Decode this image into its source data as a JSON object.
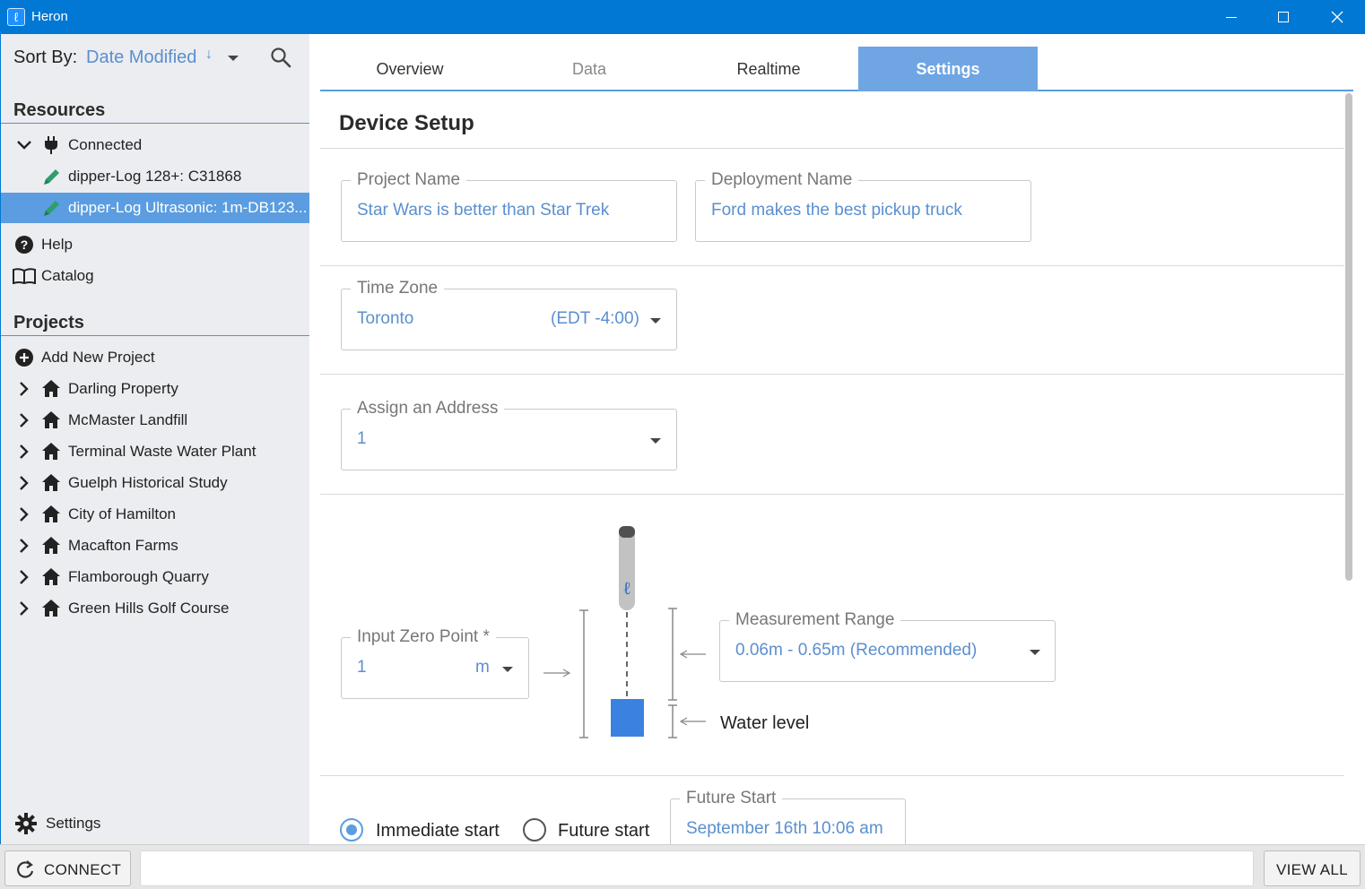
{
  "window": {
    "title": "Heron"
  },
  "sidebar": {
    "sort_label": "Sort By:",
    "sort_value": "Date Modified",
    "sort_direction": "↓",
    "resources_heading": "Resources",
    "connected_label": "Connected",
    "devices": [
      {
        "label": "dipper-Log 128+: C31868"
      },
      {
        "label": "dipper-Log Ultrasonic: 1m-DB123..."
      }
    ],
    "help_label": "Help",
    "catalog_label": "Catalog",
    "projects_heading": "Projects",
    "add_project_label": "Add New Project",
    "projects": [
      {
        "label": "Darling Property"
      },
      {
        "label": "McMaster Landfill"
      },
      {
        "label": "Terminal Waste Water Plant"
      },
      {
        "label": "Guelph Historical Study"
      },
      {
        "label": "City of Hamilton"
      },
      {
        "label": "Macafton Farms"
      },
      {
        "label": "Flamborough Quarry"
      },
      {
        "label": "Green Hills Golf Course"
      }
    ],
    "settings_label": "Settings"
  },
  "tabs": [
    {
      "label": "Overview",
      "state": "normal"
    },
    {
      "label": "Data",
      "state": "disabled"
    },
    {
      "label": "Realtime",
      "state": "normal"
    },
    {
      "label": "Settings",
      "state": "active"
    }
  ],
  "device_setup": {
    "heading": "Device Setup",
    "project_name": {
      "label": "Project Name",
      "value": "Star Wars is better than Star Trek"
    },
    "deployment_name": {
      "label": "Deployment Name",
      "value": "Ford makes the best pickup truck"
    },
    "time_zone": {
      "label": "Time Zone",
      "value": "Toronto",
      "offset": "(EDT -4:00)"
    },
    "address": {
      "label": "Assign an Address",
      "value": "1"
    },
    "zero_point": {
      "label": "Input Zero Point *",
      "value": "1",
      "unit": "m"
    },
    "measurement_range": {
      "label": "Measurement Range",
      "value": "0.06m - 0.65m (Recommended)"
    },
    "water_level_label": "Water level",
    "start": {
      "immediate_label": "Immediate start",
      "future_label": "Future start",
      "selected": "immediate",
      "future_start": {
        "label": "Future Start",
        "value": "September 16th 10:06 am"
      }
    }
  },
  "bottombar": {
    "connect_label": "CONNECT",
    "view_all_label": "VIEW ALL"
  },
  "colors": {
    "accent": "#5b9de0",
    "titlebar": "#0078d4",
    "value_text": "#5b8fcf"
  }
}
